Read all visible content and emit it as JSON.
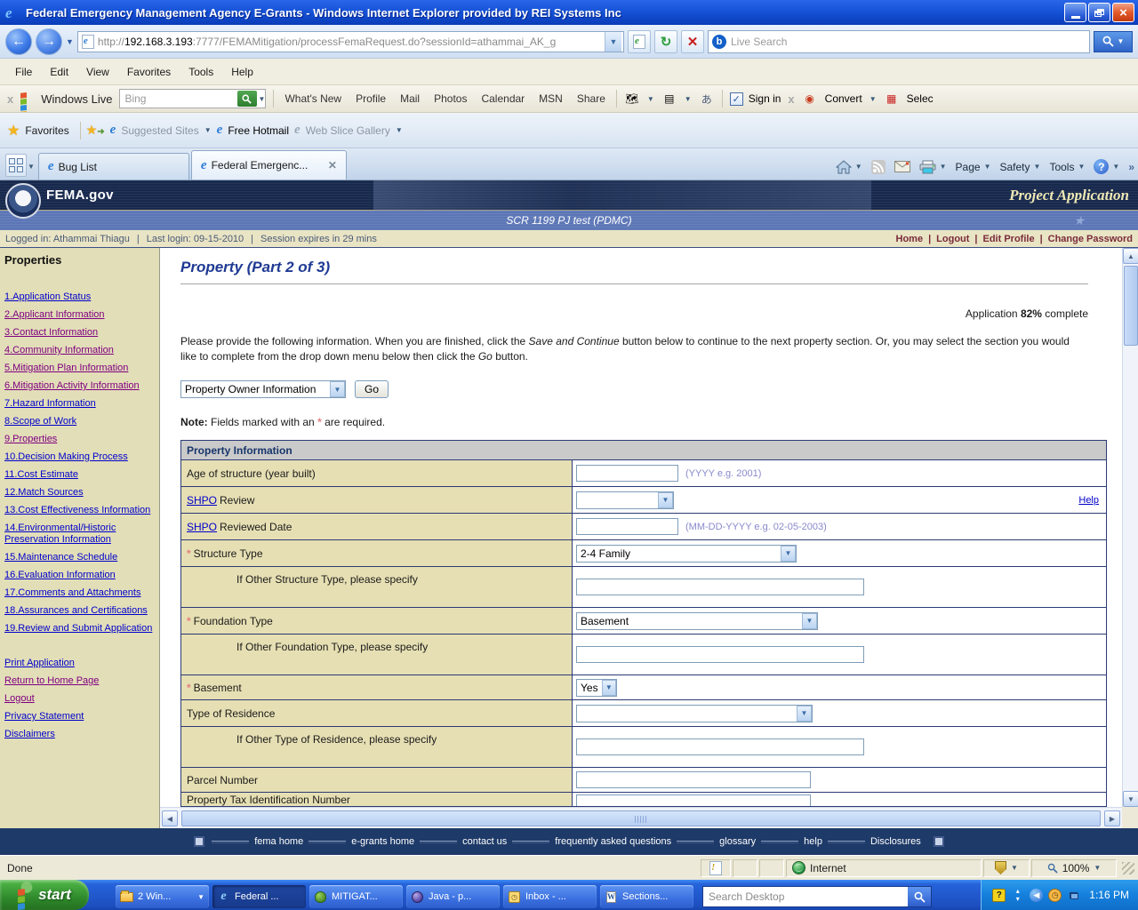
{
  "window": {
    "title": "Federal Emergency Management Agency E-Grants - Windows Internet Explorer provided by REI Systems Inc"
  },
  "browser": {
    "url_protocol": "http://",
    "url_domain": "192.168.3.193",
    "url_rest": ":7777/FEMAMitigation/processFemaRequest.do?sessionId=athammai_AK_g",
    "live_search_placeholder": "Live Search",
    "menu_items": [
      "File",
      "Edit",
      "View",
      "Favorites",
      "Tools",
      "Help"
    ],
    "live_toolbar": {
      "brand": "Windows Live",
      "bing_placeholder": "Bing",
      "links": [
        "What's New",
        "Profile",
        "Mail",
        "Photos",
        "Calendar",
        "MSN",
        "Share"
      ],
      "sign_in_label": "Sign in",
      "convert_label": "Convert",
      "select_label": "Selec"
    },
    "favorites_bar": {
      "favorites_label": "Favorites",
      "suggested_sites": "Suggested Sites",
      "free_hotmail": "Free Hotmail",
      "web_slice": "Web Slice Gallery"
    },
    "tabs": [
      {
        "label": "Bug List"
      },
      {
        "label": "Federal Emergenc..."
      }
    ],
    "command_bar": {
      "page": "Page",
      "safety": "Safety",
      "tools": "Tools"
    }
  },
  "header": {
    "brand": "FEMA.gov",
    "page_type": "Project Application",
    "app_title": "SCR 1199 PJ test (PDMC)",
    "logged_in": "Logged in: Athammai Thiagu",
    "last_login": "Last login: 09-15-2010",
    "session": "Session expires in 29 mins",
    "links": [
      "Home",
      "Logout",
      "Edit Profile",
      "Change Password"
    ]
  },
  "sidebar": {
    "heading": "Properties",
    "items": [
      {
        "label": "1.Application Status"
      },
      {
        "label": "2.Applicant Information"
      },
      {
        "label": "3.Contact Information"
      },
      {
        "label": "4.Community Information"
      },
      {
        "label": "5.Mitigation Plan Information"
      },
      {
        "label": "6.Mitigation Activity Information"
      },
      {
        "label": "7.Hazard Information"
      },
      {
        "label": "8.Scope of Work"
      },
      {
        "label": "9.Properties"
      },
      {
        "label": "10.Decision Making Process"
      },
      {
        "label": "11.Cost Estimate"
      },
      {
        "label": "12.Match Sources"
      },
      {
        "label": "13.Cost Effectiveness Information"
      },
      {
        "label": "14.Environmental/Historic Preservation Information"
      },
      {
        "label": "15.Maintenance Schedule"
      },
      {
        "label": "16.Evaluation Information"
      },
      {
        "label": "17.Comments and Attachments"
      },
      {
        "label": "18.Assurances and Certifications"
      },
      {
        "label": "19.Review and Submit Application"
      }
    ],
    "actions": [
      "Print Application",
      "Return to Home Page",
      "Logout",
      "Privacy Statement",
      "Disclaimers"
    ]
  },
  "main": {
    "title": "Property (Part 2 of 3)",
    "completion_prefix": "Application ",
    "completion_value": "82%",
    "completion_suffix": " complete",
    "instr_1": "Please provide the following information. When you are finished, click the ",
    "instr_italic_1": "Save and Continue",
    "instr_2": " button below to continue to the next property section. Or, you may select the section you would like to complete from the drop down menu below then click the ",
    "instr_italic_2": "Go",
    "instr_3": " button.",
    "section_select_value": "Property Owner Information",
    "go_label": "Go",
    "note_bold": "Note:",
    "note_1": " Fields marked with an ",
    "note_star": "*",
    "note_2": " are required.",
    "form": {
      "header": "Property Information",
      "help_label": "Help",
      "rows": [
        {
          "label": "Age of structure (year built)",
          "hint": "(YYYY e.g. 2001)"
        },
        {
          "label_link": "SHPO",
          "label": "Review"
        },
        {
          "label_link": "SHPO",
          "label": "Reviewed Date",
          "hint": "(MM-DD-YYYY e.g. 02-05-2003)"
        },
        {
          "required": "*",
          "label": "Structure Type",
          "value": "2-4 Family"
        },
        {
          "label": "If Other Structure Type, please specify"
        },
        {
          "required": "*",
          "label": "Foundation Type",
          "value": "Basement"
        },
        {
          "label": "If Other Foundation Type, please specify"
        },
        {
          "required": "*",
          "label": "Basement",
          "value": "Yes"
        },
        {
          "label": "Type of Residence",
          "value": ""
        },
        {
          "label": "If Other Type of Residence, please specify"
        },
        {
          "label": "Parcel Number"
        },
        {
          "label": "Property Tax Identification Number"
        }
      ]
    }
  },
  "footer": {
    "links": [
      "fema home",
      "e-grants home",
      "contact us",
      "frequently asked questions",
      "glossary",
      "help",
      "Disclosures"
    ]
  },
  "statusbar": {
    "status": "Done",
    "zone": "Internet",
    "zoom": "100%"
  },
  "taskbar": {
    "start_label": "start",
    "buttons": [
      "2 Win...",
      "Federal ...",
      "MITIGAT...",
      "Java - p...",
      "Inbox - ...",
      "Sections..."
    ],
    "search_placeholder": "Search Desktop",
    "time": "1:16 PM"
  }
}
